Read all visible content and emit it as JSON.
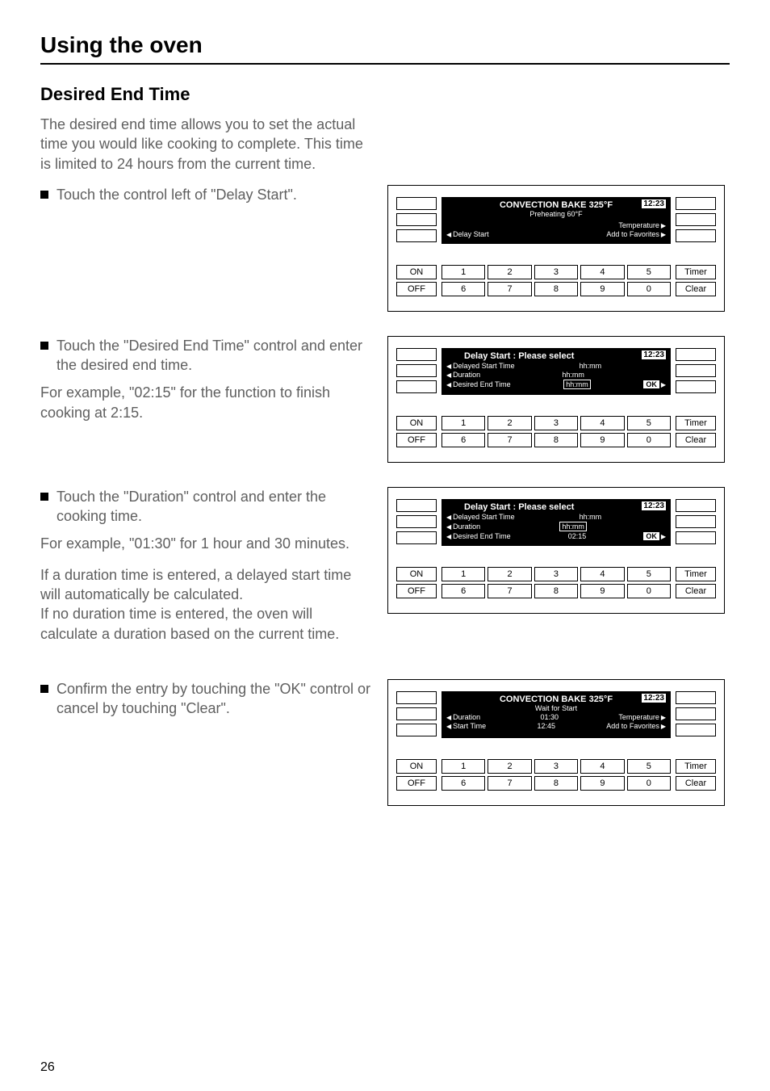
{
  "pageTitle": "Using the oven",
  "sectionTitle": "Desired End Time",
  "intro": "The desired end time allows you to set the actual time you would like cooking to complete. This time is limited to 24 hours from the current time.",
  "bullets": {
    "b1": "Touch the control left of \"Delay Start\".",
    "b2": "Touch the \"Desired End Time\" control and enter the desired end time.",
    "b2_after": "For example, \"02:15\" for the function to finish cooking at 2:15.",
    "b3": "Touch the \"Duration\" control and enter the cooking time.",
    "b3_after1": "For example, \"01:30\" for 1 hour and 30 minutes.",
    "b3_after2": "If a duration time is entered, a delayed start time will automatically be calculated.",
    "b3_after3": "If no duration time is entered, the oven will calculate a duration based on the current time.",
    "b4": "Confirm the entry by touching the \"OK\" control or cancel by touching \"Clear\"."
  },
  "panelCommon": {
    "time": "12:23",
    "on": "ON",
    "off": "OFF",
    "timer": "Timer",
    "clear": "Clear",
    "keys": [
      "1",
      "2",
      "3",
      "4",
      "5",
      "6",
      "7",
      "8",
      "9",
      "0"
    ]
  },
  "panel1": {
    "title": "CONVECTION BAKE 325°F",
    "sub": "Preheating 60°F",
    "left1": "Delay Start",
    "right1": "Temperature",
    "right2": "Add to Favorites"
  },
  "panel2": {
    "title": "Delay Start : Please select",
    "l1": "Delayed Start Time",
    "v1": "hh:mm",
    "l2": "Duration",
    "v2": "hh:mm",
    "l3": "Desired End Time",
    "v3": "hh:mm",
    "ok": "OK"
  },
  "panel3": {
    "title": "Delay Start : Please select",
    "l1": "Delayed Start Time",
    "v1": "hh:mm",
    "l2": "Duration",
    "v2": "hh:mm",
    "l3": "Desired End Time",
    "v3": "02:15",
    "ok": "OK"
  },
  "panel4": {
    "title": "CONVECTION BAKE 325°F",
    "sub": "Wait for Start",
    "l1": "Duration",
    "v1": "01:30",
    "l2": "Start Time",
    "v2": "12:45",
    "right1": "Temperature",
    "right2": "Add to Favorites"
  },
  "pageNumber": "26"
}
